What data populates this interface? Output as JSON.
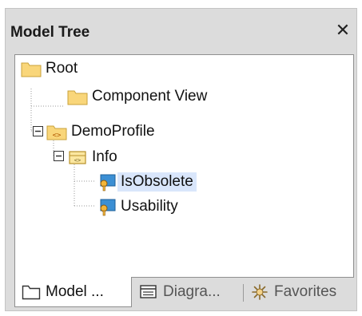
{
  "panel": {
    "title": "Model Tree",
    "close_glyph": "✕"
  },
  "tree": {
    "nodes": [
      {
        "label": "Root",
        "icon": "folder-icon",
        "depth": 0
      },
      {
        "label": "Component View",
        "icon": "folder-icon",
        "depth": 1
      },
      {
        "label": "DemoProfile",
        "icon": "profile-folder-icon",
        "depth": 1,
        "expanded": true
      },
      {
        "label": "Info",
        "icon": "stereotype-icon",
        "depth": 2,
        "expanded": true
      },
      {
        "label": "IsObsolete",
        "icon": "tag-key-icon",
        "depth": 3,
        "selected": true
      },
      {
        "label": "Usability",
        "icon": "tag-key-icon",
        "depth": 3
      }
    ]
  },
  "tabs": [
    {
      "label": "Model ...",
      "icon": "folder-outline-icon",
      "active": true
    },
    {
      "label": "Diagra...",
      "icon": "diagram-list-icon",
      "active": false
    },
    {
      "label": "Favorites",
      "icon": "favorites-star-icon",
      "active": false
    }
  ],
  "colors": {
    "folder": "#f9d67a",
    "selection": "#d9e6fb",
    "tag": "#3b8fd4"
  }
}
